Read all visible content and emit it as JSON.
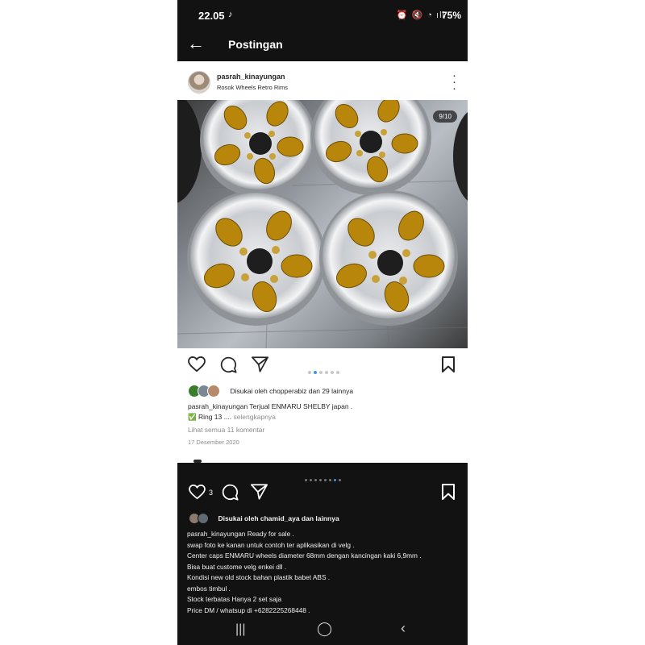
{
  "status_bar": {
    "time": "22.05",
    "app_icon": "tiktok-icon",
    "battery": "75%"
  },
  "header": {
    "title": "Postingan"
  },
  "post1": {
    "username": "pasrah_kinayungan",
    "location": "Rosok Wheels Retro Rims",
    "image_counter": "9/10",
    "carousel": {
      "count": 6,
      "active": 1
    },
    "likes_text": "Disukai oleh chopperabiz dan 29 lainnya",
    "caption_line1": "pasrah_kinayungan Terjual  ENMARU SHELBY  japan .",
    "caption_line2_prefix": "✅",
    "caption_line2": "Ring 13 .... ",
    "more_label": "selengkapnya",
    "comments_link": "Lihat semua 11 komentar",
    "date": "17 Desember 2020"
  },
  "post2": {
    "carousel": {
      "count": 8,
      "active": 6
    },
    "like_count": "3",
    "likes_text": "Disukai oleh chamid_aya dan lainnya",
    "caption_lines": [
      "pasrah_kinayungan Ready for sale .",
      "swap foto ke kanan untuk contoh ter aplikasikan di velg .",
      "Center caps ENMARU wheels diameter 68mm dengan kancingan kaki 6,9mm .",
      "Bisa buat custome velg enkei dll .",
      "Kondisi new old stock bahan plastik babet ABS .",
      "embos timbul .",
      "Stock terbatas Hanya 2 set saja",
      "Price DM / whatsup di +6282225268448 ."
    ]
  },
  "colors": {
    "accent": "#3897f0",
    "dark_bg": "#121212",
    "light_bg": "#ffffff",
    "gold": "#b8860b"
  }
}
